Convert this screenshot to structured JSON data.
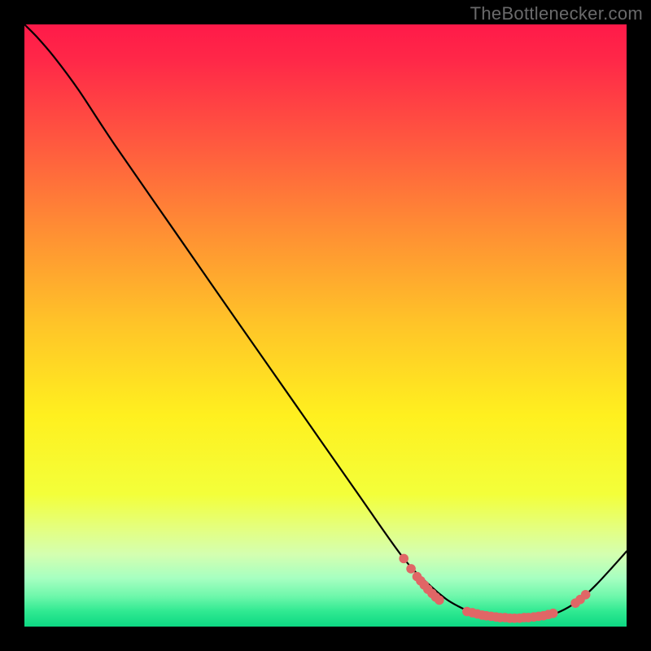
{
  "attribution": "TheBottlenecker.com",
  "chart_data": {
    "type": "line",
    "title": "",
    "xlabel": "",
    "ylabel": "",
    "xlim": [
      0,
      100
    ],
    "ylim": [
      0,
      100
    ],
    "gradient_stops": [
      {
        "offset": 0.0,
        "color": "#ff1a49"
      },
      {
        "offset": 0.06,
        "color": "#ff2848"
      },
      {
        "offset": 0.2,
        "color": "#ff5a3f"
      },
      {
        "offset": 0.35,
        "color": "#ff9133"
      },
      {
        "offset": 0.5,
        "color": "#ffc528"
      },
      {
        "offset": 0.65,
        "color": "#fff01f"
      },
      {
        "offset": 0.78,
        "color": "#f3ff3a"
      },
      {
        "offset": 0.84,
        "color": "#e3ff83"
      },
      {
        "offset": 0.88,
        "color": "#d4ffb0"
      },
      {
        "offset": 0.92,
        "color": "#a6ffc1"
      },
      {
        "offset": 0.95,
        "color": "#6df7ab"
      },
      {
        "offset": 0.975,
        "color": "#2fe991"
      },
      {
        "offset": 1.0,
        "color": "#0dd883"
      }
    ],
    "series": [
      {
        "name": "bottleneck-curve",
        "points": [
          {
            "x": 0.0,
            "y": 100.0
          },
          {
            "x": 2.0,
            "y": 98.0
          },
          {
            "x": 5.0,
            "y": 94.5
          },
          {
            "x": 9.0,
            "y": 89.1
          },
          {
            "x": 15.0,
            "y": 80.0
          },
          {
            "x": 25.0,
            "y": 65.6
          },
          {
            "x": 35.0,
            "y": 51.2
          },
          {
            "x": 45.0,
            "y": 36.9
          },
          {
            "x": 55.0,
            "y": 22.6
          },
          {
            "x": 63.0,
            "y": 11.3
          },
          {
            "x": 67.5,
            "y": 6.7
          },
          {
            "x": 70.0,
            "y": 4.6
          },
          {
            "x": 72.0,
            "y": 3.4
          },
          {
            "x": 74.0,
            "y": 2.5
          },
          {
            "x": 77.0,
            "y": 1.8
          },
          {
            "x": 80.0,
            "y": 1.4
          },
          {
            "x": 83.0,
            "y": 1.4
          },
          {
            "x": 86.0,
            "y": 1.7
          },
          {
            "x": 88.5,
            "y": 2.3
          },
          {
            "x": 91.0,
            "y": 3.6
          },
          {
            "x": 93.0,
            "y": 5.1
          },
          {
            "x": 95.0,
            "y": 7.0
          },
          {
            "x": 97.5,
            "y": 9.7
          },
          {
            "x": 100.0,
            "y": 12.5
          }
        ]
      }
    ],
    "marker_groups": [
      {
        "name": "left-descent-cluster",
        "points": [
          {
            "x": 63.0,
            "y": 11.3
          },
          {
            "x": 64.2,
            "y": 9.6
          },
          {
            "x": 65.2,
            "y": 8.3
          },
          {
            "x": 65.8,
            "y": 7.6
          },
          {
            "x": 66.4,
            "y": 6.9
          },
          {
            "x": 67.0,
            "y": 6.2
          },
          {
            "x": 67.7,
            "y": 5.5
          },
          {
            "x": 68.3,
            "y": 4.9
          },
          {
            "x": 68.9,
            "y": 4.4
          }
        ]
      },
      {
        "name": "valley-cluster",
        "points": [
          {
            "x": 73.5,
            "y": 2.5
          },
          {
            "x": 74.4,
            "y": 2.3
          },
          {
            "x": 75.2,
            "y": 2.1
          },
          {
            "x": 76.0,
            "y": 1.9
          },
          {
            "x": 76.7,
            "y": 1.8
          },
          {
            "x": 77.5,
            "y": 1.7
          },
          {
            "x": 78.3,
            "y": 1.6
          },
          {
            "x": 79.0,
            "y": 1.5
          },
          {
            "x": 79.8,
            "y": 1.5
          },
          {
            "x": 80.6,
            "y": 1.4
          },
          {
            "x": 81.4,
            "y": 1.4
          },
          {
            "x": 82.2,
            "y": 1.4
          },
          {
            "x": 83.0,
            "y": 1.5
          },
          {
            "x": 83.7,
            "y": 1.5
          },
          {
            "x": 84.6,
            "y": 1.6
          },
          {
            "x": 85.4,
            "y": 1.7
          },
          {
            "x": 86.2,
            "y": 1.8
          },
          {
            "x": 87.0,
            "y": 2.0
          },
          {
            "x": 87.8,
            "y": 2.2
          }
        ]
      },
      {
        "name": "right-ascent-cluster",
        "points": [
          {
            "x": 91.5,
            "y": 3.9
          },
          {
            "x": 92.3,
            "y": 4.5
          },
          {
            "x": 93.2,
            "y": 5.3
          }
        ]
      }
    ],
    "marker_color": "#e06666",
    "marker_radius": 5.8,
    "curve_color": "#000000",
    "curve_width": 2.2
  }
}
